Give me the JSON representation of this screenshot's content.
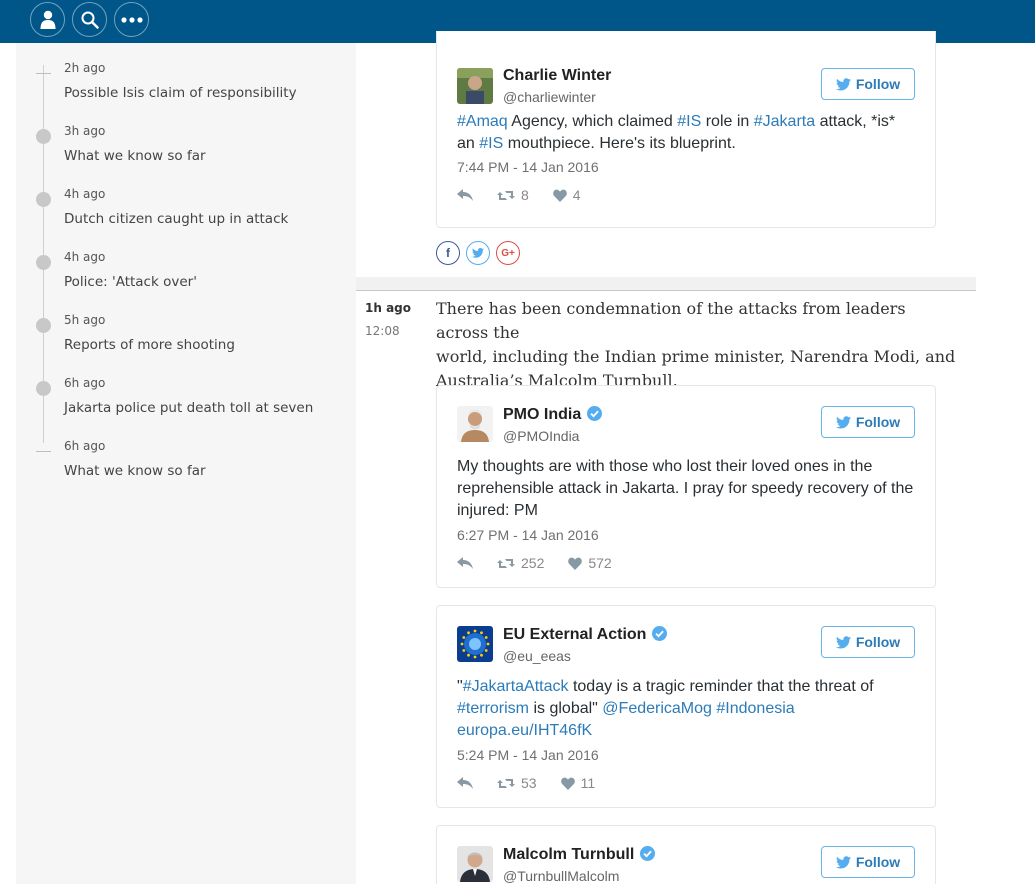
{
  "topbar": {
    "buttons": [
      {
        "icon": "profile-icon"
      },
      {
        "icon": "search-icon"
      },
      {
        "icon": "more-icon"
      }
    ]
  },
  "sidebar": {
    "items": [
      {
        "time": "2h ago",
        "title": "Possible Isis claim of responsibility",
        "marker": "dash"
      },
      {
        "time": "3h ago",
        "title": "What we know so far",
        "marker": "dot"
      },
      {
        "time": "4h ago",
        "title": "Dutch citizen caught up in attack",
        "marker": "dot"
      },
      {
        "time": "4h ago",
        "title": "Police: 'Attack over'",
        "marker": "dot"
      },
      {
        "time": "5h ago",
        "title": "Reports of more shooting",
        "marker": "dot"
      },
      {
        "time": "6h ago",
        "title": "Jakarta police put death toll at seven",
        "marker": "dot"
      },
      {
        "time": "6h ago",
        "title": "What we know so far",
        "marker": "dash"
      }
    ]
  },
  "follow_label": "Follow",
  "tweet_charlie": {
    "name": "Charlie Winter",
    "handle": "@charliewinter",
    "text1_tag": "#Amaq",
    "text1_a": " Agency, which claimed ",
    "text1_tag2": "#IS",
    "text1_b": " role in ",
    "text1_tag3": "#Jakarta",
    "text1_c": " attack, *is*",
    "text2_a": "an ",
    "text2_tag": "#IS",
    "text2_b": " mouthpiece. Here's its blueprint.",
    "date": "7:44 PM - 14 Jan 2016",
    "retweets": "8",
    "likes": "4"
  },
  "share": {
    "facebook": "f",
    "twitter": "t",
    "google": "G+"
  },
  "post": {
    "time_ago": "1h ago",
    "clock": "12:08",
    "line1": "There has been condemnation of the attacks from leaders across the",
    "line2": "world, including the Indian prime minister, Narendra Modi, and",
    "line3": "Australia’s Malcolm Turnbull."
  },
  "tweet_pmo": {
    "name": "PMO India",
    "handle": "@PMOIndia",
    "line1": "My thoughts are with those who lost their loved ones in the",
    "line2": "reprehensible attack in Jakarta. I pray for speedy recovery of the",
    "line3": "injured: PM",
    "date": "6:27 PM - 14 Jan 2016",
    "retweets": "252",
    "likes": "572"
  },
  "tweet_eu": {
    "name": "EU External Action",
    "handle": "@eu_eeas",
    "l1_pre": "\"",
    "l1_tag": "#JakartaAttack",
    "l1_post": " today is a tragic reminder that the threat of",
    "l2_tag": "#terrorism",
    "l2_mid": " is global\" ",
    "l2_mention": "@FedericaMog",
    "l2_sp": " ",
    "l2_tag2": "#Indonesia",
    "l3_link": "europa.eu/IHT46fK",
    "date": "5:24 PM - 14 Jan 2016",
    "retweets": "53",
    "likes": "11"
  },
  "tweet_turnbull": {
    "name": "Malcolm Turnbull",
    "handle": "@TurnbullMalcolm"
  },
  "colors": {
    "nav": "#005689",
    "link": "#2b7bb9",
    "verified": "#55acee",
    "sidebar_bg": "#f6f6f6"
  }
}
